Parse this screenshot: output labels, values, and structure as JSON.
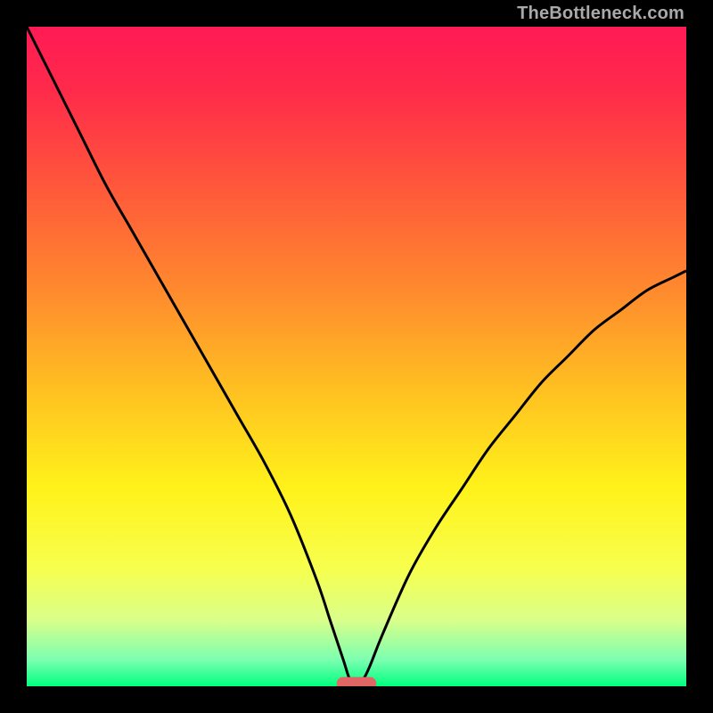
{
  "attribution": "TheBottleneck.com",
  "chart_data": {
    "type": "line",
    "title": "",
    "xlabel": "",
    "ylabel": "",
    "xlim": [
      0,
      100
    ],
    "ylim": [
      0,
      100
    ],
    "grid": false,
    "legend": false,
    "background": {
      "gradient_stops": [
        {
          "offset": 0.0,
          "color": "#ff1a55"
        },
        {
          "offset": 0.1,
          "color": "#ff2b4a"
        },
        {
          "offset": 0.25,
          "color": "#ff5a3a"
        },
        {
          "offset": 0.4,
          "color": "#ff8a2e"
        },
        {
          "offset": 0.55,
          "color": "#ffc021"
        },
        {
          "offset": 0.7,
          "color": "#fff21a"
        },
        {
          "offset": 0.82,
          "color": "#f7ff4d"
        },
        {
          "offset": 0.9,
          "color": "#d9ff8a"
        },
        {
          "offset": 0.96,
          "color": "#7bffb0"
        },
        {
          "offset": 1.0,
          "color": "#00ff80"
        }
      ]
    },
    "series": [
      {
        "name": "bottleneck-curve",
        "color": "#000000",
        "x": [
          0,
          4,
          8,
          12,
          16,
          20,
          24,
          28,
          32,
          36,
          40,
          44,
          46,
          48,
          49,
          50,
          51,
          52,
          54,
          58,
          62,
          66,
          70,
          74,
          78,
          82,
          86,
          90,
          94,
          98,
          100
        ],
        "y": [
          100,
          92,
          84,
          76,
          69,
          62,
          55,
          48,
          41,
          34,
          26,
          16,
          10,
          4,
          1,
          0,
          1,
          3,
          8,
          17,
          24,
          30,
          36,
          41,
          46,
          50,
          54,
          57,
          60,
          62,
          63
        ]
      }
    ],
    "marker": {
      "name": "optimum-marker",
      "x": 50,
      "y": 0,
      "width": 6,
      "height": 2,
      "color": "#e06666"
    }
  }
}
